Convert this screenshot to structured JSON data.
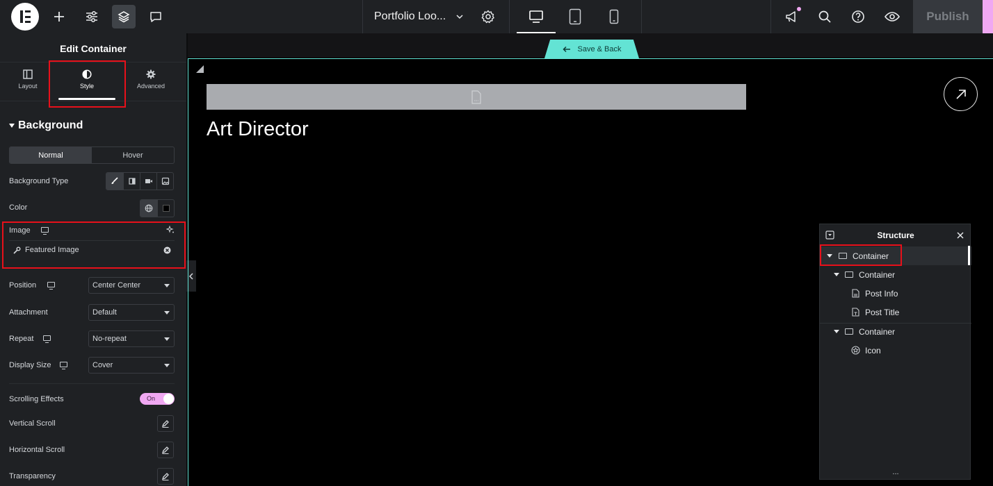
{
  "topbar": {
    "document_title": "Portfolio Loo...",
    "publish_label": "Publish"
  },
  "panel": {
    "title": "Edit Container",
    "tabs": [
      {
        "label": "Layout"
      },
      {
        "label": "Style"
      },
      {
        "label": "Advanced"
      }
    ],
    "active_tab": "Style",
    "section_title": "Background",
    "state_tabs": [
      "Normal",
      "Hover"
    ],
    "active_state": "Normal",
    "background_type_label": "Background Type",
    "color_label": "Color",
    "image_label": "Image",
    "image_value": "Featured Image",
    "position": {
      "label": "Position",
      "value": "Center Center"
    },
    "attachment": {
      "label": "Attachment",
      "value": "Default"
    },
    "repeat": {
      "label": "Repeat",
      "value": "No-repeat"
    },
    "display_size": {
      "label": "Display Size",
      "value": "Cover"
    },
    "scrolling_effects": {
      "label": "Scrolling Effects",
      "toggle": "On"
    },
    "vertical_scroll_label": "Vertical Scroll",
    "horizontal_scroll_label": "Horizontal Scroll",
    "transparency_label": "Transparency"
  },
  "canvas": {
    "save_back_label": "Save & Back",
    "heading": "Art Director"
  },
  "structure": {
    "title": "Structure",
    "items": [
      {
        "label": "Container"
      },
      {
        "label": "Container"
      },
      {
        "label": "Post Info"
      },
      {
        "label": "Post Title"
      },
      {
        "label": "Container"
      },
      {
        "label": "Icon"
      }
    ],
    "more": "..."
  },
  "colors": {
    "accent_teal": "#63e3d4",
    "accent_pink": "#f0a8f2",
    "highlight_red": "#e8101a",
    "panel_bg": "#1f2124"
  }
}
